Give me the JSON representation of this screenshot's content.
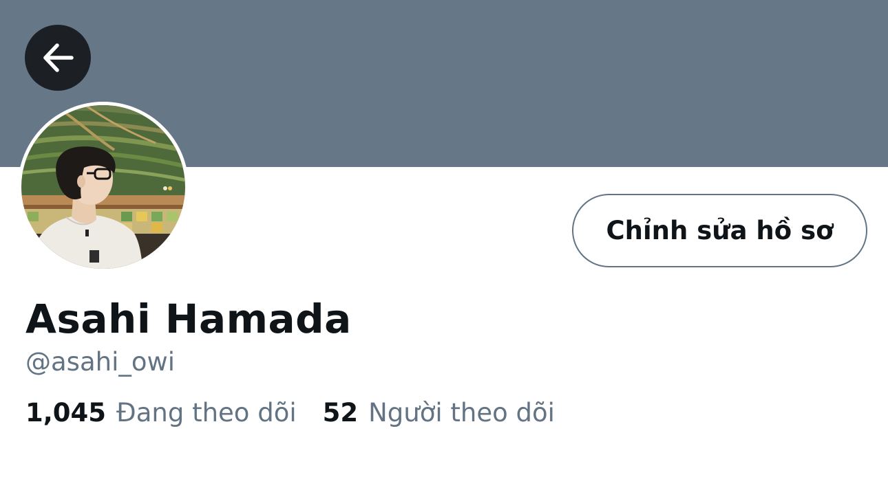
{
  "colors": {
    "banner": "#667788",
    "back_button": "#1c2024",
    "text_primary": "#0f1419",
    "text_secondary": "#627384",
    "button_border": "#627384"
  },
  "header": {
    "back_icon": "arrow-left-icon"
  },
  "profile": {
    "display_name": "Asahi Hamada",
    "handle": "@asahi_owi",
    "edit_button_label": "Chỉnh sửa hồ sơ",
    "avatar_icon": "profile-photo"
  },
  "stats": {
    "following": {
      "count": "1,045",
      "label": "Đang theo dõi"
    },
    "followers": {
      "count": "52",
      "label": "Người theo dõi"
    }
  }
}
